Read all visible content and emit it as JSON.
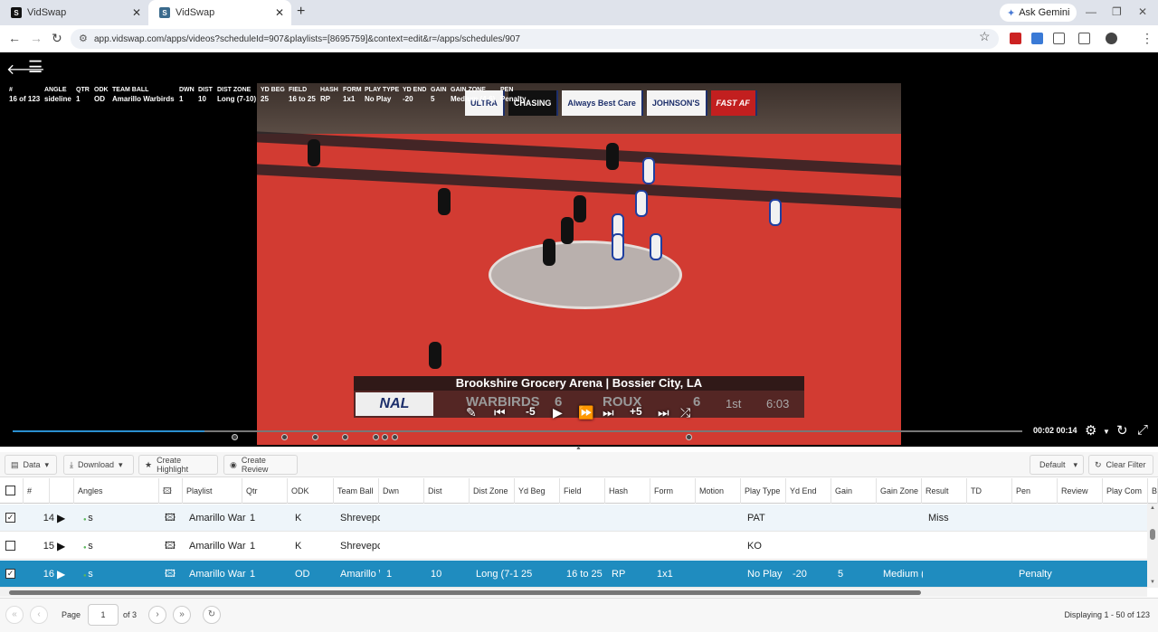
{
  "browser": {
    "tabs": [
      {
        "label": "VidSwap"
      },
      {
        "label": "VidSwap"
      }
    ],
    "ask_gemini": "Ask Gemini",
    "url": "app.vidswap.com/apps/videos?scheduleId=907&playlists=[8695759]&context=edit&r=/apps/schedules/907"
  },
  "overlay": {
    "headers": [
      "#",
      "ANGLE",
      "QTR",
      "ODK",
      "TEAM BALL",
      "DWN",
      "DIST",
      "DIST ZONE",
      "YD BEG",
      "FIELD",
      "HASH",
      "FORM",
      "PLAY TYPE",
      "YD END",
      "GAIN",
      "GAIN ZONE",
      "PEN"
    ],
    "values": [
      "16 of 123",
      "sideline",
      "1",
      "OD",
      "Amarillo Warbirds",
      "1",
      "10",
      "Long (7-10)",
      "25",
      "16 to 25",
      "RP",
      "1x1",
      "No Play",
      "-20",
      "5",
      "Medium (4-6)",
      "Penalty"
    ]
  },
  "scorebug": {
    "arena": "Brookshire Grocery Arena | Bossier City, LA",
    "league": "NAL",
    "home": "WARBIRDS",
    "home_score": "6",
    "away": "ROUX",
    "away_score": "6",
    "quarter": "1st",
    "clock": "6:03"
  },
  "video_controls": {
    "skip_back": "-5",
    "skip_forward": "+5",
    "time": "00:02 00:14",
    "progress": 0.19
  },
  "toolbar": {
    "data": "Data",
    "download": "Download",
    "create_highlight": "Create Highlight",
    "create_review": "Create Review",
    "view": "Default",
    "clear_filter": "Clear Filter"
  },
  "grid": {
    "columns": [
      "#",
      "Angles",
      "Playlist",
      "Qtr",
      "ODK",
      "Team Ball",
      "Dwn",
      "Dist",
      "Dist Zone",
      "Yd Beg",
      "Field",
      "Hash",
      "Form",
      "Motion",
      "Play Type",
      "Yd End",
      "Gain",
      "Gain Zone",
      "Result",
      "TD",
      "Pen",
      "Review",
      "Play Com",
      "B"
    ],
    "rows": [
      {
        "checked": true,
        "num": "14",
        "angle": "s",
        "playlist": "Amarillo War",
        "qtr": "1",
        "odk": "K",
        "team": "Shrevepc",
        "dwn": "",
        "dist": "",
        "dist_zone": "",
        "yd_beg": "",
        "field": "",
        "hash": "",
        "form": "",
        "play_type": "PAT",
        "yd_end": "",
        "gain": "",
        "gain_zone": "",
        "result": "Miss",
        "pen": ""
      },
      {
        "checked": false,
        "num": "15",
        "angle": "s",
        "playlist": "Amarillo War",
        "qtr": "1",
        "odk": "K",
        "team": "Shrevepc",
        "dwn": "",
        "dist": "",
        "dist_zone": "",
        "yd_beg": "",
        "field": "",
        "hash": "",
        "form": "",
        "play_type": "KO",
        "yd_end": "",
        "gain": "",
        "gain_zone": "",
        "result": "",
        "pen": ""
      },
      {
        "checked": true,
        "num": "16",
        "angle": "s",
        "playlist": "Amarillo War",
        "qtr": "1",
        "odk": "OD",
        "team": "Amarillo \\",
        "dwn": "1",
        "dist": "10",
        "dist_zone": "Long (7-1",
        "yd_beg": "25",
        "field": "16 to 25",
        "hash": "RP",
        "form": "1x1",
        "play_type": "No Play",
        "yd_end": "-20",
        "gain": "5",
        "gain_zone": "Medium (",
        "result": "",
        "pen": "Penalty"
      }
    ]
  },
  "pager": {
    "page_label": "Page",
    "page": "1",
    "of": "of 3",
    "displaying": "Displaying 1 - 50 of 123"
  },
  "colors": {
    "accent": "#1f8cbf",
    "field": "#d23b32"
  }
}
